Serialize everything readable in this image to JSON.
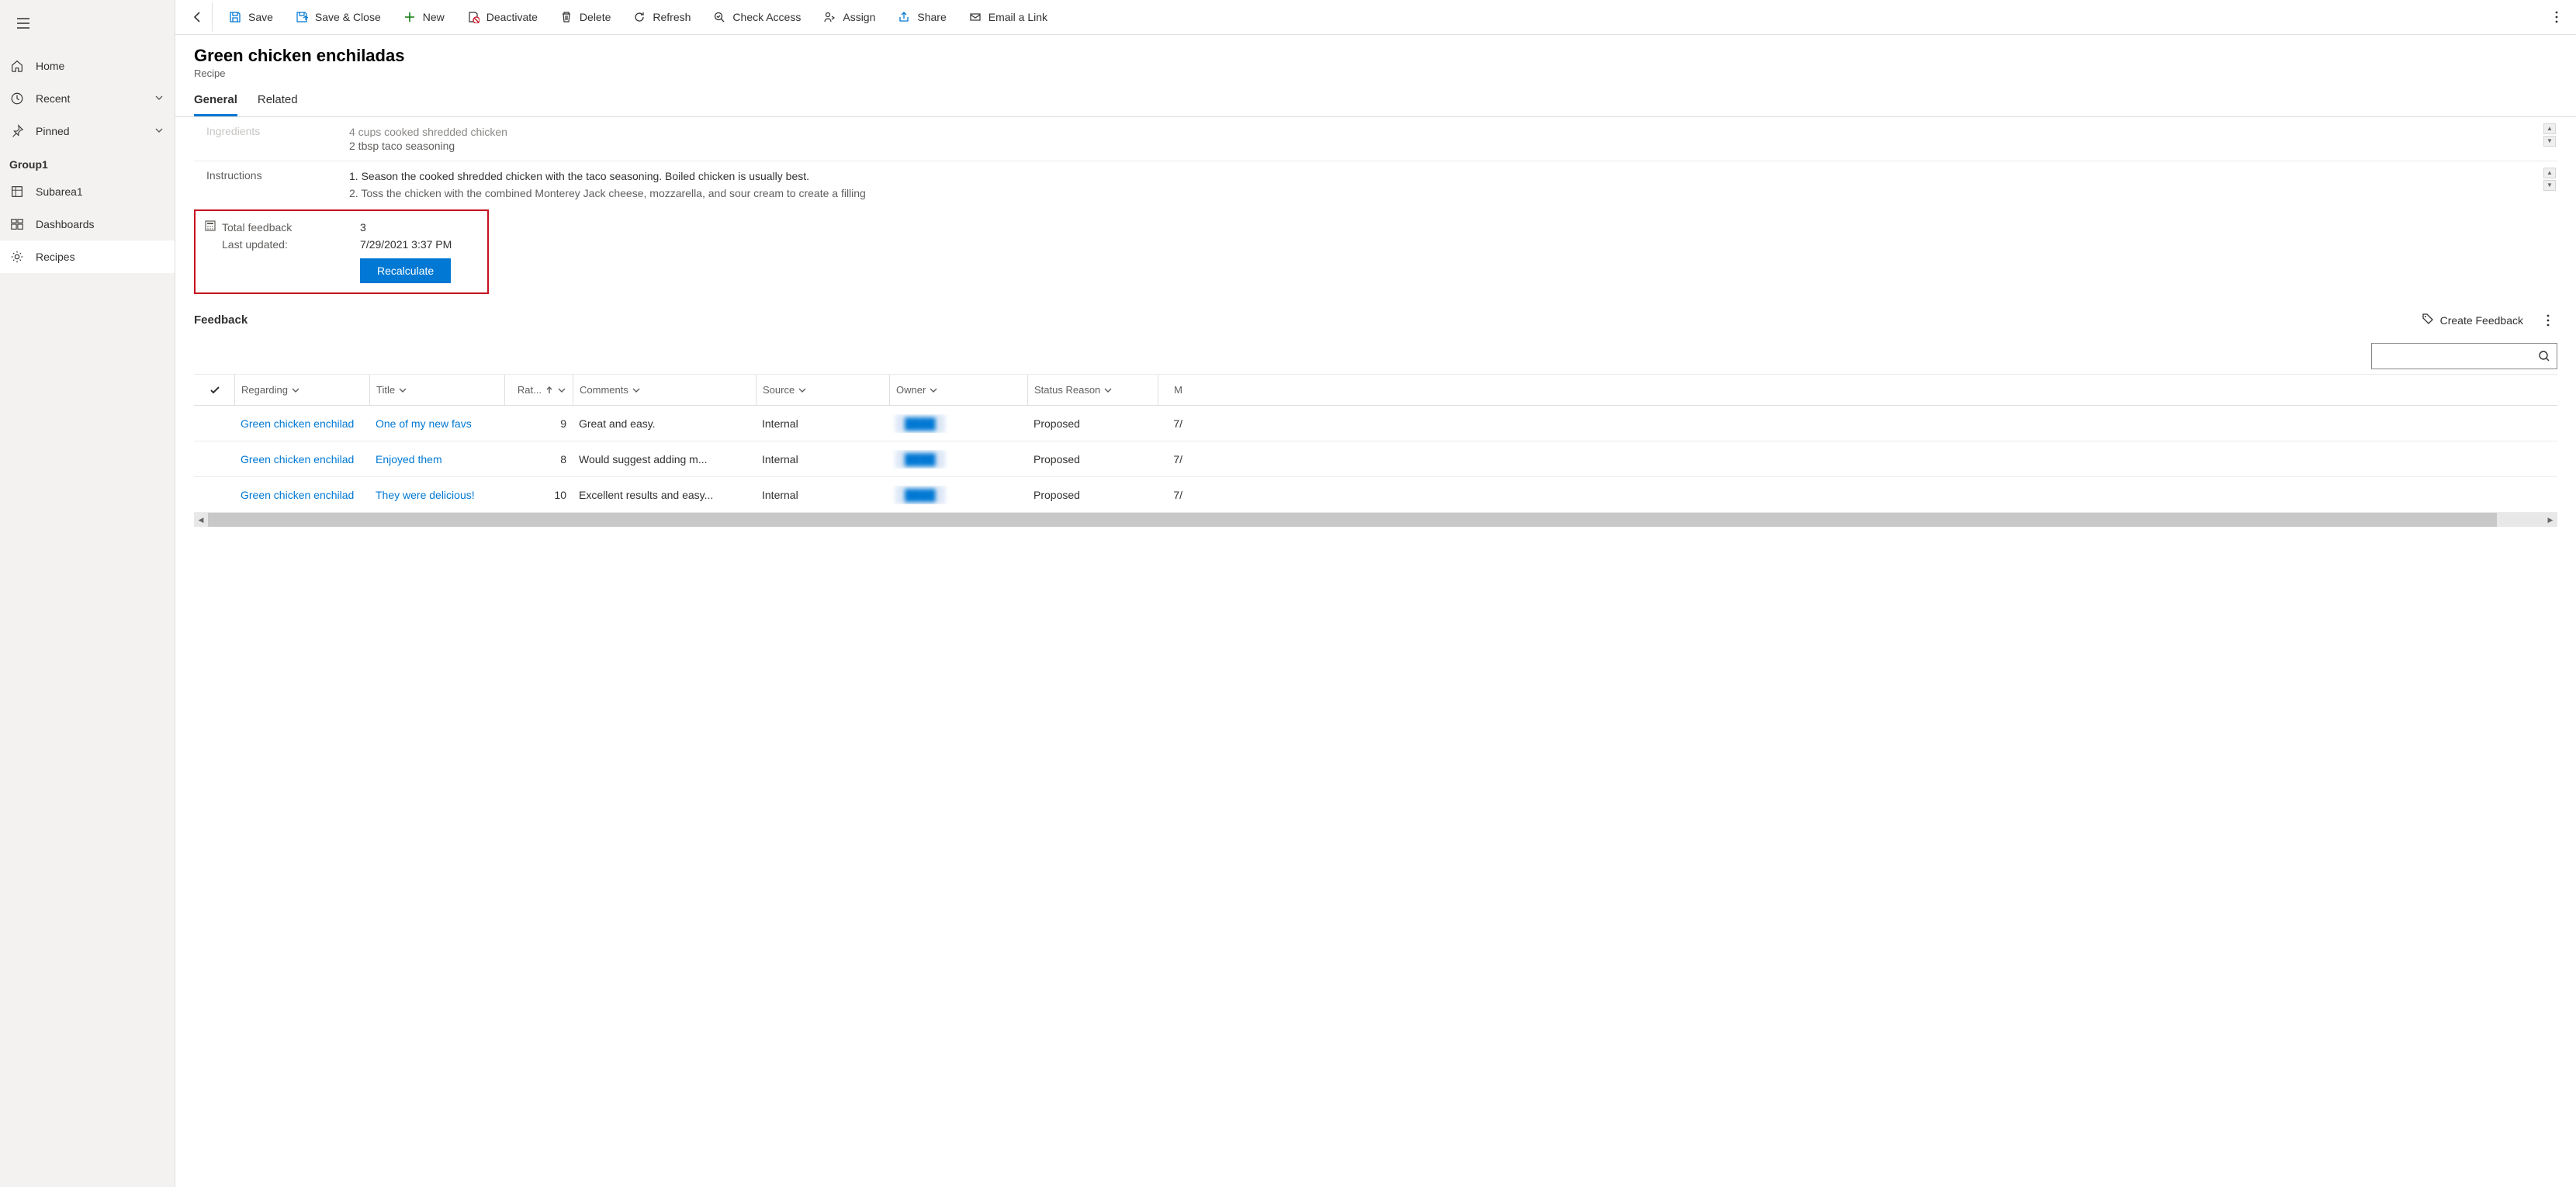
{
  "sidebar": {
    "home": "Home",
    "recent": "Recent",
    "pinned": "Pinned",
    "group_label": "Group1",
    "items": [
      {
        "label": "Subarea1"
      },
      {
        "label": "Dashboards"
      },
      {
        "label": "Recipes"
      }
    ]
  },
  "commands": {
    "save": "Save",
    "save_close": "Save & Close",
    "new": "New",
    "deactivate": "Deactivate",
    "delete": "Delete",
    "refresh": "Refresh",
    "check_access": "Check Access",
    "assign": "Assign",
    "share": "Share",
    "email_link": "Email a Link"
  },
  "page": {
    "title": "Green chicken enchiladas",
    "entity": "Recipe"
  },
  "tabs": {
    "general": "General",
    "related": "Related"
  },
  "form": {
    "ingredients_label": "Ingredients",
    "ingredients_line1": "4 cups cooked shredded chicken",
    "ingredients_line2": "2 tbsp taco seasoning",
    "instructions_label": "Instructions",
    "instructions_line1": "1. Season the cooked shredded chicken with the taco seasoning. Boiled chicken is usually best.",
    "instructions_line2": "2. Toss the chicken with the combined Monterey Jack cheese, mozzarella, and sour cream to create a filling"
  },
  "rollup": {
    "total_label": "Total feedback",
    "total_value": "3",
    "updated_label": "Last updated:",
    "updated_value": "7/29/2021 3:37 PM",
    "button": "Recalculate"
  },
  "feedback": {
    "title": "Feedback",
    "create": "Create Feedback",
    "columns": {
      "regarding": "Regarding",
      "title": "Title",
      "rating": "Rat...",
      "comments": "Comments",
      "source": "Source",
      "owner": "Owner",
      "status": "Status Reason",
      "m": "M"
    },
    "rows": [
      {
        "regarding": "Green chicken enchilad",
        "title": "One of my new favs",
        "rating": "9",
        "comments": "Great and easy.",
        "source": "Internal",
        "owner": "████",
        "status": "Proposed",
        "m": "7/"
      },
      {
        "regarding": "Green chicken enchilad",
        "title": "Enjoyed them",
        "rating": "8",
        "comments": "Would suggest adding m...",
        "source": "Internal",
        "owner": "████",
        "status": "Proposed",
        "m": "7/"
      },
      {
        "regarding": "Green chicken enchilad",
        "title": "They were delicious!",
        "rating": "10",
        "comments": "Excellent results and easy...",
        "source": "Internal",
        "owner": "████",
        "status": "Proposed",
        "m": "7/"
      }
    ]
  }
}
